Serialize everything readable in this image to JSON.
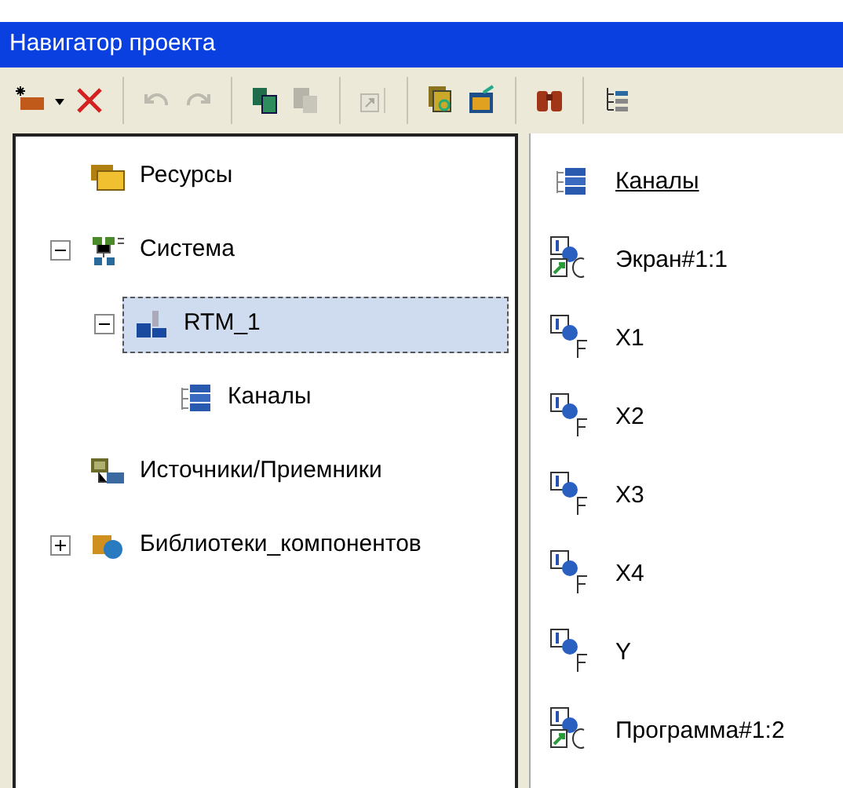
{
  "window": {
    "title": "Навигатор проекта"
  },
  "toolbar": [
    {
      "kind": "new",
      "disabled": false
    },
    {
      "kind": "dropdown",
      "disabled": false
    },
    {
      "kind": "delete",
      "disabled": false
    },
    {
      "kind": "separator"
    },
    {
      "kind": "undo",
      "disabled": true
    },
    {
      "kind": "redo",
      "disabled": true
    },
    {
      "kind": "separator"
    },
    {
      "kind": "copy",
      "disabled": false
    },
    {
      "kind": "paste",
      "disabled": true
    },
    {
      "kind": "separator"
    },
    {
      "kind": "resize",
      "disabled": true
    },
    {
      "kind": "separator"
    },
    {
      "kind": "pages",
      "disabled": false
    },
    {
      "kind": "properties",
      "disabled": false
    },
    {
      "kind": "separator"
    },
    {
      "kind": "find",
      "disabled": false
    },
    {
      "kind": "separator"
    },
    {
      "kind": "tree",
      "disabled": false
    }
  ],
  "tree": [
    {
      "label": "Ресурсы",
      "kind": "folders",
      "selected": false
    },
    {
      "label": "Система",
      "kind": "network",
      "expanded": true,
      "selected": false,
      "children": [
        {
          "label": "RTM_1",
          "kind": "node",
          "expanded": true,
          "selected": true,
          "children": [
            {
              "label": "Каналы",
              "kind": "list",
              "selected": false
            }
          ]
        }
      ]
    },
    {
      "label": "Источники/Приемники",
      "kind": "sources",
      "selected": false
    },
    {
      "label": "Библиотеки_компонентов",
      "kind": "library",
      "expanded": false,
      "selected": false
    }
  ],
  "list": [
    {
      "label": "Каналы",
      "kind": "link"
    },
    {
      "label": "Экран#1:1",
      "kind": "C"
    },
    {
      "label": "X1",
      "kind": "F"
    },
    {
      "label": "X2",
      "kind": "F"
    },
    {
      "label": "X3",
      "kind": "F"
    },
    {
      "label": "X4",
      "kind": "F"
    },
    {
      "label": "Y",
      "kind": "F"
    },
    {
      "label": "Программа#1:2",
      "kind": "C"
    }
  ]
}
